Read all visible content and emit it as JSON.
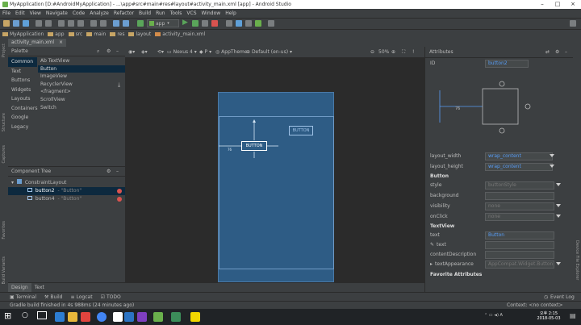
{
  "window": {
    "title": "MyApplication [D:#AndroidMyApplication] - ...\\app#src#main#res#layout#activity_main.xml [app] - Android Studio"
  },
  "menu": [
    "File",
    "Edit",
    "View",
    "Navigate",
    "Code",
    "Analyze",
    "Refactor",
    "Build",
    "Run",
    "Tools",
    "VCS",
    "Window",
    "Help"
  ],
  "toolbar": {
    "run_config": "app"
  },
  "breadcrumb": [
    "MyApplication",
    "app",
    "src",
    "main",
    "res",
    "layout",
    "activity_main.xml"
  ],
  "editor_tab": "activity_main.xml",
  "palette": {
    "title": "Palette",
    "categories": [
      "Common",
      "Text",
      "Buttons",
      "Widgets",
      "Layouts",
      "Containers",
      "Google",
      "Legacy"
    ],
    "items": [
      "Ab TextView",
      "Button",
      "ImageView",
      "RecyclerView",
      "<fragment>",
      "ScrollView",
      "Switch"
    ]
  },
  "design_toolbar": {
    "device": "Nexus 4",
    "api": "P",
    "theme": "AppTheme",
    "locale": "Default (en-us)",
    "zoom": "50%"
  },
  "canvas": {
    "button_label": "BUTTON",
    "margin_label": "76"
  },
  "component_tree": {
    "title": "Component Tree",
    "root": "ConstraintLayout",
    "children": [
      {
        "id": "button2",
        "text": "- \"Button\""
      },
      {
        "id": "button4",
        "text": "- \"Button\""
      }
    ]
  },
  "attributes": {
    "title": "Attributes",
    "id_label": "ID",
    "id_value": "button2",
    "inspector_margin": "76",
    "layout_width_label": "layout_width",
    "layout_width": "wrap_content",
    "layout_height_label": "layout_height",
    "layout_height": "wrap_content",
    "section_button": "Button",
    "style_label": "style",
    "style": "buttonStyle",
    "background_label": "background",
    "visibility_label": "visibility",
    "visibility": "none",
    "onclick_label": "onClick",
    "onclick": "none",
    "section_textview": "TextView",
    "text_label": "text",
    "text": "Button",
    "text2_label": "text",
    "content_desc_label": "contentDescription",
    "text_appearance_label": "textAppearance",
    "text_appearance": "AppCompat.Widget.Button",
    "section_fav": "Favorite Attributes"
  },
  "bottom_tabs": [
    "Design",
    "Text"
  ],
  "tool_windows": [
    "Terminal",
    "Build",
    "Logcat",
    "TODO"
  ],
  "event_log": "Event Log",
  "status": {
    "message": "Gradle build finished in 4s 988ms (24 minutes ago)",
    "context": "Context: <no context>"
  },
  "side_labels": {
    "left": [
      "Project",
      "Structure",
      "Captures",
      "Favorites",
      "Build Variants"
    ],
    "right": [
      "Device File Explorer"
    ]
  },
  "clock": {
    "time": "오후 2:15",
    "date": "2018-05-03"
  },
  "colors": {
    "accent": "#589df6",
    "canvas_blue": "#2e5c85",
    "error": "#d9534f"
  }
}
